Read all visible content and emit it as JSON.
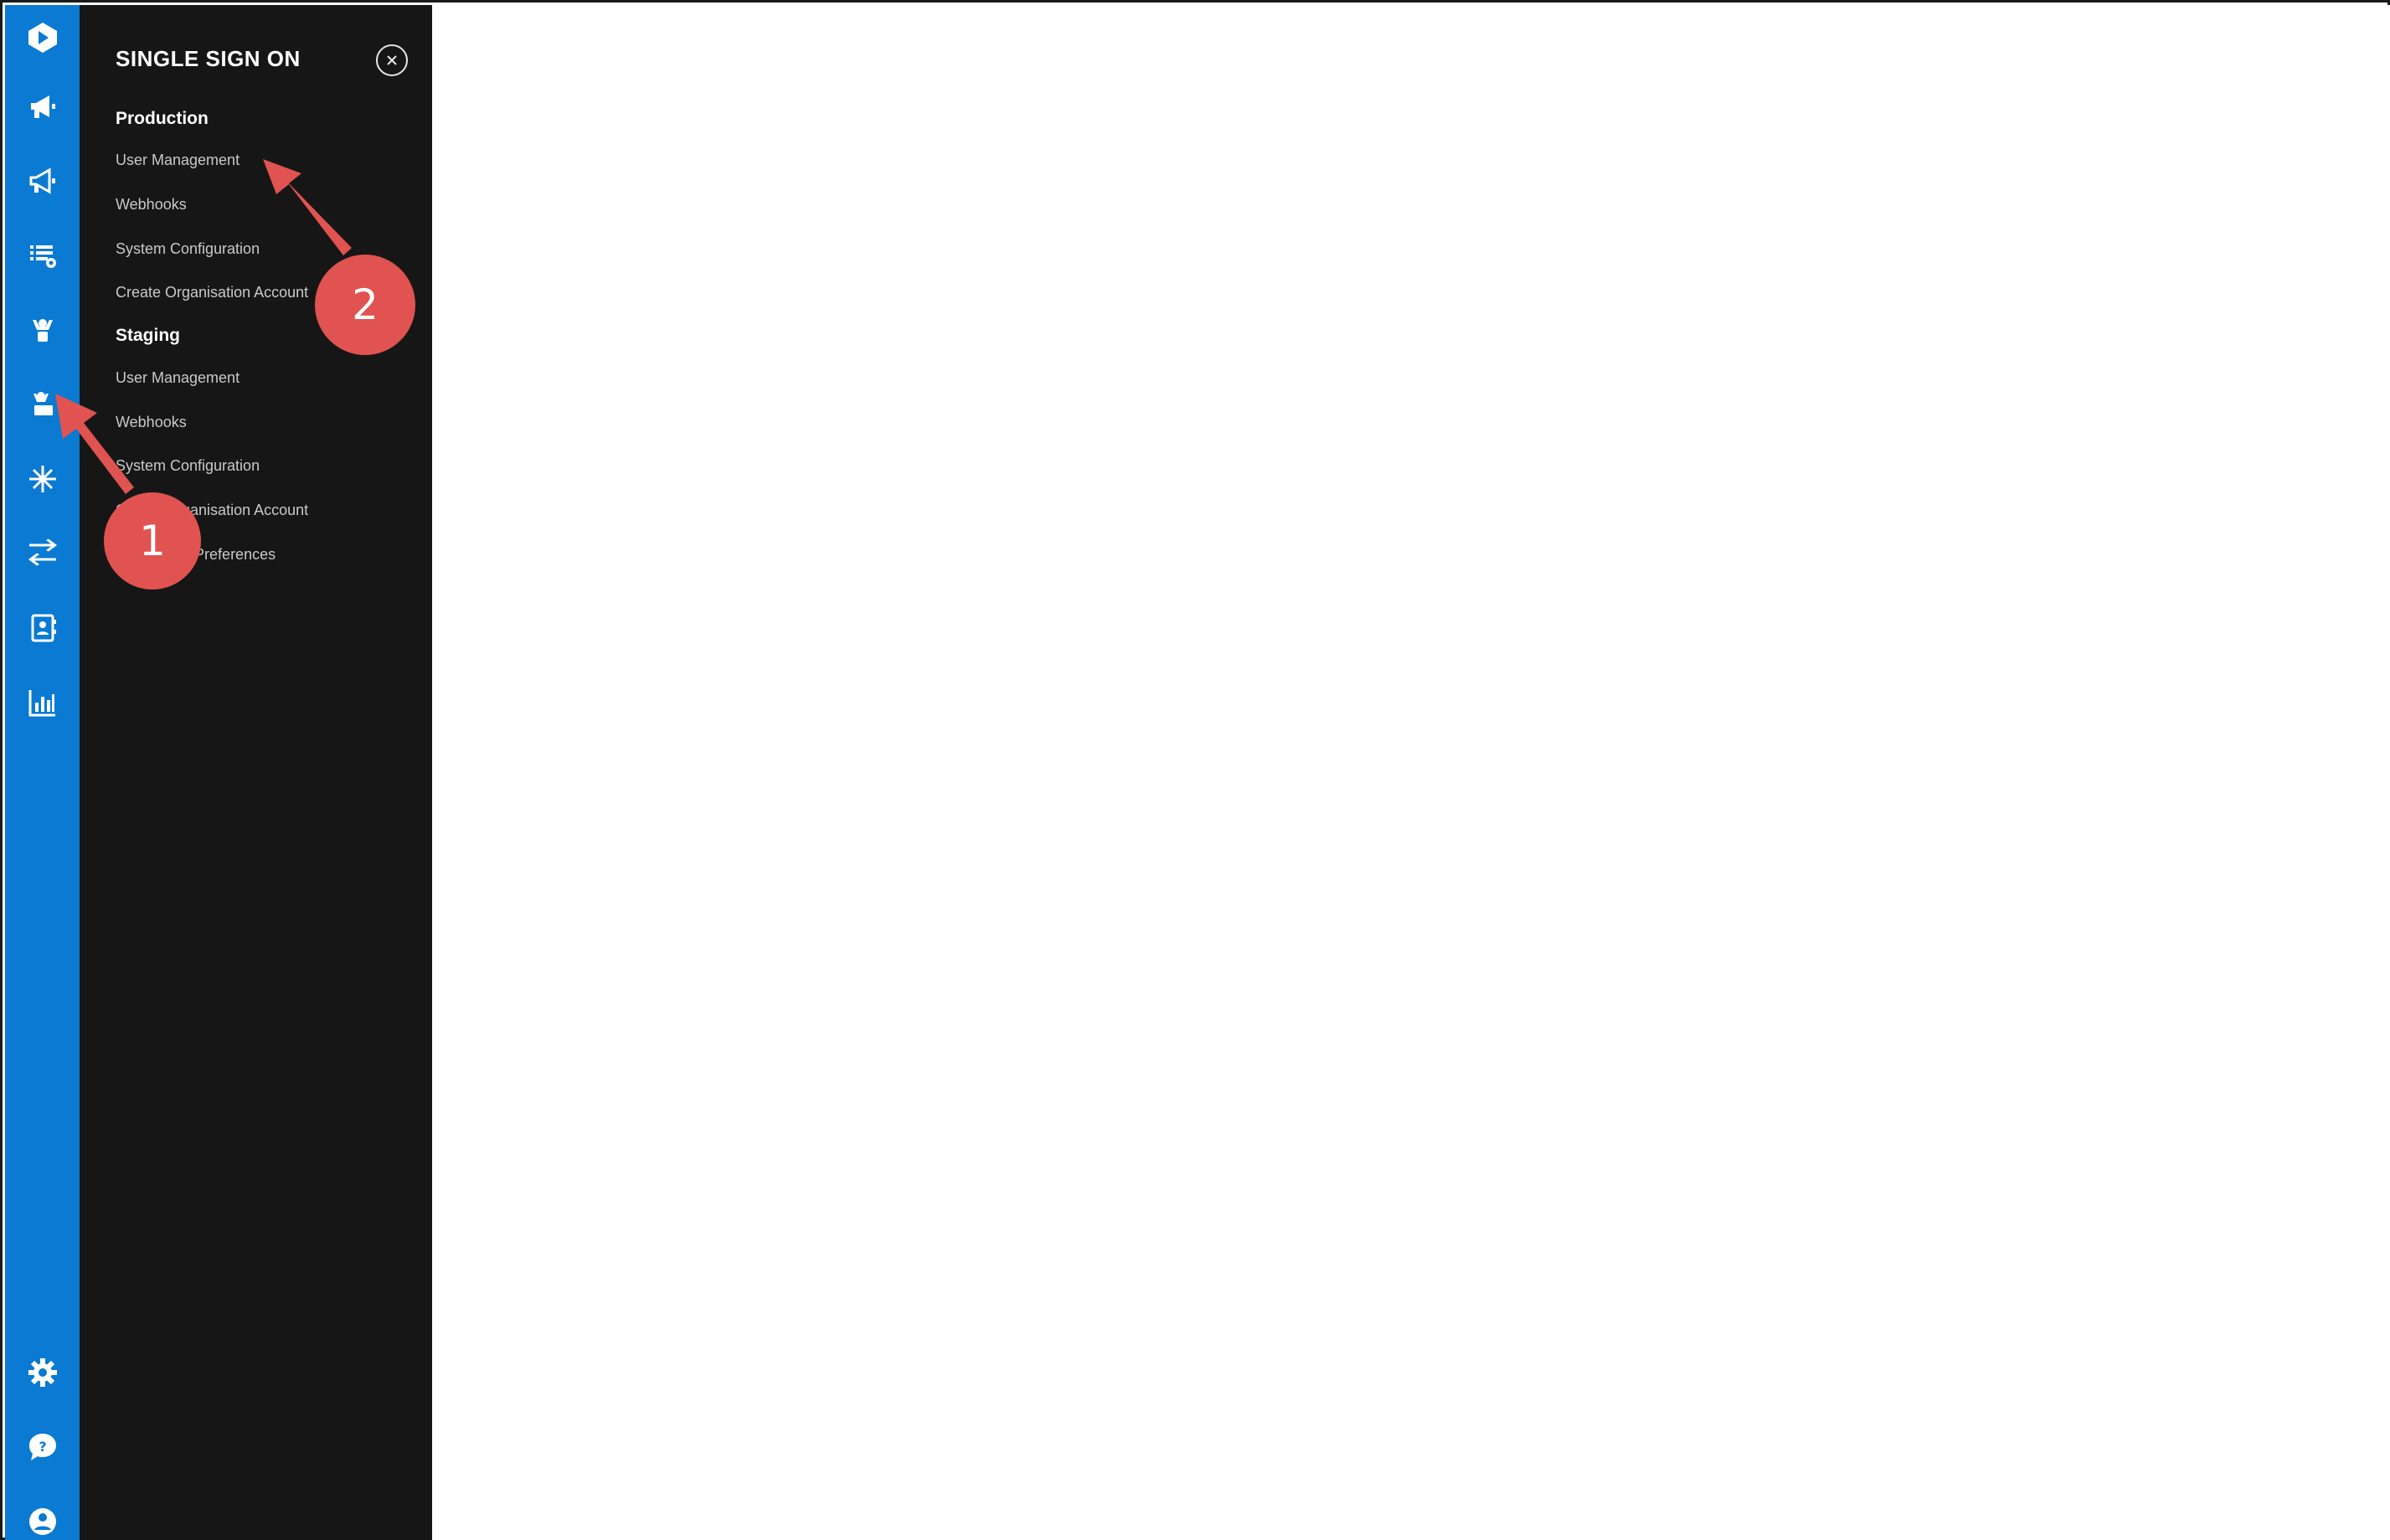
{
  "rail": {
    "items": [
      {
        "icon": "logo-icon"
      },
      {
        "icon": "megaphone-icon"
      },
      {
        "icon": "megaphone-outline-icon"
      },
      {
        "icon": "list-settings-icon"
      },
      {
        "icon": "user-raised-hands-icon"
      },
      {
        "icon": "user-laptop-icon"
      },
      {
        "icon": "snowflake-icon"
      },
      {
        "icon": "transfer-arrows-icon"
      },
      {
        "icon": "contact-book-icon"
      },
      {
        "icon": "bar-chart-icon"
      }
    ],
    "bottom_items": [
      {
        "icon": "gear-icon"
      },
      {
        "icon": "help-bubble-icon"
      },
      {
        "icon": "user-avatar-icon"
      }
    ],
    "color": "#0a7ad3"
  },
  "panel": {
    "title": "SINGLE SIGN ON",
    "close_label": "×",
    "background": "#161616",
    "sections": [
      {
        "heading": "Production",
        "items": [
          "User Management",
          "Webhooks",
          "System Configuration",
          "Create Organisation Account"
        ]
      },
      {
        "heading": "Staging",
        "items": [
          "User Management",
          "Webhooks",
          "System Configuration",
          "Create Organisation Account",
          "Notification Preferences"
        ]
      }
    ]
  },
  "annotations": {
    "color": "#e05350",
    "callouts": [
      {
        "label": "1"
      },
      {
        "label": "2"
      }
    ]
  }
}
